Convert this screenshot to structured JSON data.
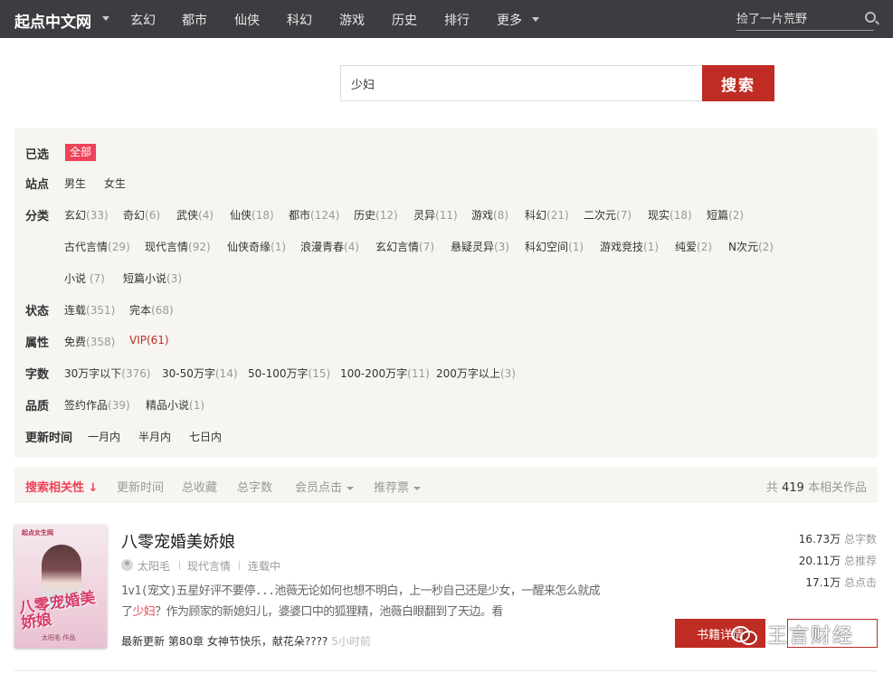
{
  "nav": {
    "logo": "起点中文网",
    "items": [
      "玄幻",
      "都市",
      "仙侠",
      "科幻",
      "游戏",
      "历史",
      "排行",
      "更多"
    ],
    "search_placeholder": "捡了一片荒野"
  },
  "search": {
    "value": "少妇",
    "button": "搜索"
  },
  "filters": {
    "selected": {
      "label": "已选",
      "value": "全部"
    },
    "site": {
      "label": "站点",
      "options": [
        "男生",
        "女生"
      ]
    },
    "category": {
      "label": "分类",
      "options": [
        {
          "name": "玄幻",
          "count": "(33)"
        },
        {
          "name": "奇幻",
          "count": "(6)"
        },
        {
          "name": "武侠",
          "count": "(4)"
        },
        {
          "name": "仙侠",
          "count": "(18)"
        },
        {
          "name": "都市",
          "count": "(124)"
        },
        {
          "name": "历史",
          "count": "(12)"
        },
        {
          "name": "灵异",
          "count": "(11)"
        },
        {
          "name": "游戏",
          "count": "(8)"
        },
        {
          "name": "科幻",
          "count": "(21)"
        },
        {
          "name": "二次元",
          "count": "(7)"
        },
        {
          "name": "现实",
          "count": "(18)"
        },
        {
          "name": "短篇",
          "count": "(2)"
        },
        {
          "name": "古代言情",
          "count": "(29)"
        },
        {
          "name": "现代言情",
          "count": "(92)"
        },
        {
          "name": "仙侠奇缘",
          "count": "(1)"
        },
        {
          "name": "浪漫青春",
          "count": "(4)"
        },
        {
          "name": "玄幻言情",
          "count": "(7)"
        },
        {
          "name": "悬疑灵异",
          "count": "(3)"
        },
        {
          "name": "科幻空间",
          "count": "(1)"
        },
        {
          "name": "游戏竞技",
          "count": "(1)"
        },
        {
          "name": "纯爱",
          "count": "(2)"
        },
        {
          "name": "N次元",
          "count": "(2)"
        },
        {
          "name": "小说 ",
          "count": "(7)"
        },
        {
          "name": "短篇小说",
          "count": "(3)"
        }
      ]
    },
    "status": {
      "label": "状态",
      "options": [
        {
          "name": "连载",
          "count": "(351)"
        },
        {
          "name": "完本",
          "count": "(68)"
        }
      ]
    },
    "attribute": {
      "label": "属性",
      "options": [
        {
          "name": "免费",
          "count": "(358)"
        },
        {
          "name": "VIP",
          "count": "(61)"
        }
      ]
    },
    "wordcount": {
      "label": "字数",
      "options": [
        {
          "name": "30万字以下",
          "count": "(376)"
        },
        {
          "name": "30-50万字",
          "count": "(14)"
        },
        {
          "name": "50-100万字",
          "count": "(15)"
        },
        {
          "name": "100-200万字",
          "count": "(11)"
        },
        {
          "name": "200万字以上",
          "count": "(3)"
        }
      ]
    },
    "quality": {
      "label": "品质",
      "options": [
        {
          "name": "签约作品",
          "count": "(39)"
        },
        {
          "name": "精品小说",
          "count": "(1)"
        }
      ]
    },
    "update": {
      "label": "更新时间",
      "options": [
        "一月内",
        "半月内",
        "七日内"
      ]
    }
  },
  "sort": {
    "items": [
      "搜索相关性 ↓",
      "更新时间",
      "总收藏",
      "总字数",
      "会员点击",
      "推荐票"
    ],
    "total_prefix": "共",
    "total_count": "419",
    "total_suffix": "本相关作品"
  },
  "book": {
    "title": "八零宠婚美娇娘",
    "cover": {
      "logo": "起点女生网",
      "title": "八零宠婚美娇娘",
      "author": "太阳毛 作品"
    },
    "author": "太阳毛",
    "category": "现代言情",
    "status": "连载中",
    "intro_before": "1v1(宠文)五星好评不要停...池薇无论如何也想不明白，上一秒自己还是少女，一醒来怎么就成了",
    "intro_highlight": "少妇",
    "intro_after": "？作为顾家的新媳妇儿，婆婆口中的狐狸精，池薇白眼翻到了天边。看",
    "update_label": "最新更新",
    "update_chapter": "第80章 女神节快乐，献花朵????",
    "update_time": "5小时前",
    "stats": [
      {
        "value": "16.73万",
        "unit": "总字数"
      },
      {
        "value": "20.11万",
        "unit": "总推荐"
      },
      {
        "value": "17.1万",
        "unit": "总点击"
      }
    ],
    "detail_button": "书籍详情",
    "watermark": "王言财经"
  },
  "colors": {
    "accent": "#bf2c24",
    "highlight": "#ed4259",
    "nav_bg": "#3c3d40",
    "panel_bg": "#f6f5f1"
  }
}
